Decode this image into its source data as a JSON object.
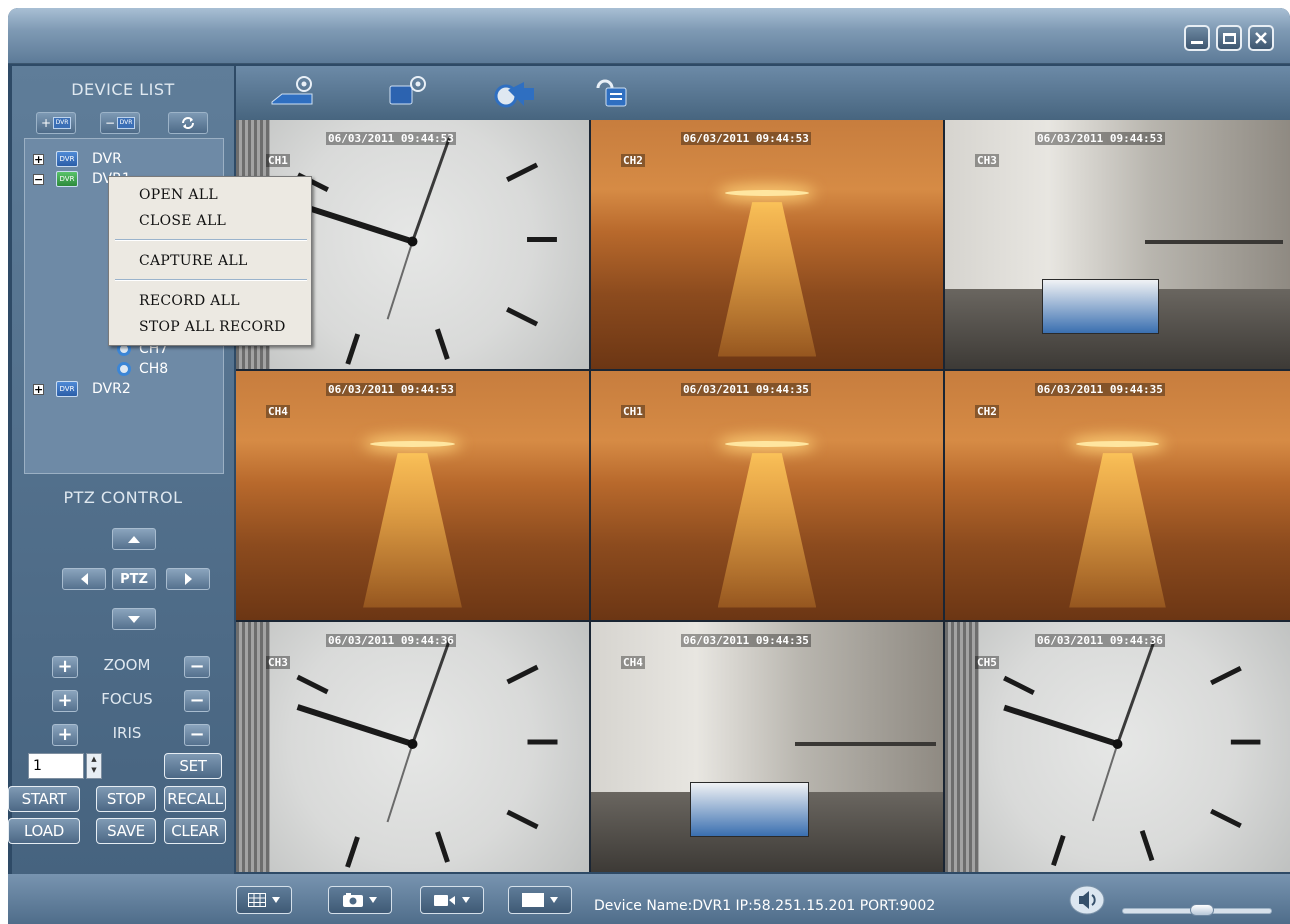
{
  "device_list": {
    "title": "DEVICE LIST",
    "add_label": "+",
    "remove_label": "−",
    "tree": [
      {
        "label": "DVR",
        "expander": "+",
        "icon": "dvr-icon"
      },
      {
        "label": "DVR1",
        "expander": "−",
        "icon": "dvr-icon"
      },
      {
        "label": "CH7",
        "icon": "camera-icon"
      },
      {
        "label": "CH8",
        "icon": "camera-icon"
      },
      {
        "label": "DVR2",
        "expander": "+",
        "icon": "dvr-icon"
      }
    ]
  },
  "context_menu": {
    "items": [
      "OPEN ALL",
      "CLOSE ALL",
      "CAPTURE ALL",
      "RECORD ALL",
      "STOP ALL RECORD"
    ]
  },
  "ptz": {
    "title": "PTZ CONTROL",
    "center_label": "PTZ",
    "zoom_label": "ZOOM",
    "focus_label": "FOCUS",
    "iris_label": "IRIS",
    "plus": "+",
    "minus": "−",
    "preset_value": "1",
    "set_label": "SET",
    "start_label": "START",
    "stop_label": "STOP",
    "recall_label": "RECALL",
    "load_label": "LOAD",
    "save_label": "SAVE",
    "clear_label": "CLEAR"
  },
  "channels": [
    {
      "label": "CH1",
      "timestamp": "06/03/2011 09:44:53",
      "scene": "clock"
    },
    {
      "label": "CH2",
      "timestamp": "06/03/2011 09:44:53",
      "scene": "sea"
    },
    {
      "label": "CH3",
      "timestamp": "06/03/2011 09:44:53",
      "scene": "room"
    },
    {
      "label": "CH4",
      "timestamp": "06/03/2011 09:44:53",
      "scene": "sea"
    },
    {
      "label": "CH1",
      "timestamp": "06/03/2011 09:44:35",
      "scene": "sea"
    },
    {
      "label": "CH2",
      "timestamp": "06/03/2011 09:44:35",
      "scene": "sea"
    },
    {
      "label": "CH3",
      "timestamp": "06/03/2011 09:44:36",
      "scene": "clock"
    },
    {
      "label": "CH4",
      "timestamp": "06/03/2011 09:44:35",
      "scene": "room"
    },
    {
      "label": "CH5",
      "timestamp": "06/03/2011 09:44:36",
      "scene": "clock"
    }
  ],
  "status": {
    "device_info": "Device Name:DVR1  IP:58.251.15.201  PORT:9002",
    "volume": 0.6
  }
}
